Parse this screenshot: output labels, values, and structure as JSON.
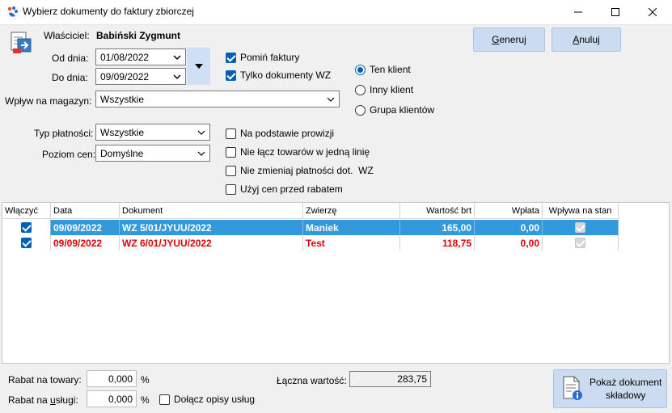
{
  "window": {
    "title": "Wybierz dokumenty do faktury zbiorczej"
  },
  "owner": {
    "label": "Właściciel:",
    "name": "Babiński Zygmunt"
  },
  "dates": {
    "from_label": "Od dnia:",
    "from_value": "01/08/2022",
    "to_label": "Do dnia:",
    "to_value": "09/09/2022"
  },
  "options": {
    "skip_invoices": "Pomiń faktury",
    "only_wz": "Tylko dokumenty WZ"
  },
  "clients": {
    "this_client": "Ten klient",
    "other_client": "Inny klient",
    "client_group": "Grupa klientów"
  },
  "buttons": {
    "generate_pre": "",
    "generate_u": "G",
    "generate_post": "eneruj",
    "cancel_pre": "",
    "cancel_u": "A",
    "cancel_post": "nuluj",
    "show_doc_line1": "Pokaż dokument",
    "show_doc_line2": "składowy"
  },
  "warehouse": {
    "label": "Wpływ na magazyn:",
    "value": "Wszystkie"
  },
  "payment": {
    "label": "Typ płatności:",
    "value": "Wszystkie"
  },
  "price_level": {
    "label": "Poziom cen:",
    "value": "Domyślne"
  },
  "flags": {
    "commission": "Na podstawie prowizji",
    "no_merge": "Nie łącz towarów w jedną linię",
    "no_change_payment": "Nie zmieniaj płatności dot.  WZ",
    "pre_discount": "Użyj cen przed rabatem"
  },
  "table": {
    "headers": [
      "Włączyć",
      "Data",
      "Dokument",
      "Zwierzę",
      "Wartość brt",
      "Wpłata",
      "Wpływa na stan"
    ],
    "rows": [
      {
        "date": "09/09/2022",
        "document": "WZ 5/01/JYUU/2022",
        "animal": "Maniek",
        "value": "165,00",
        "payment": "0,00"
      },
      {
        "date": "09/09/2022",
        "document": "WZ 6/01/JYUU/2022",
        "animal": "Test",
        "value": "118,75",
        "payment": "0,00"
      }
    ]
  },
  "footer": {
    "discount_goods_label": "Rabat na towary:",
    "discount_goods_value": "0,000",
    "discount_services_label_pre": "Rabat na ",
    "discount_services_label_u": "u",
    "discount_services_label_post": "sługi:",
    "discount_services_value": "0,000",
    "percent": "%",
    "attach_desc": "Dołącz opisy usług",
    "total_label": "Łączna wartość:",
    "total_value": "283,75"
  }
}
